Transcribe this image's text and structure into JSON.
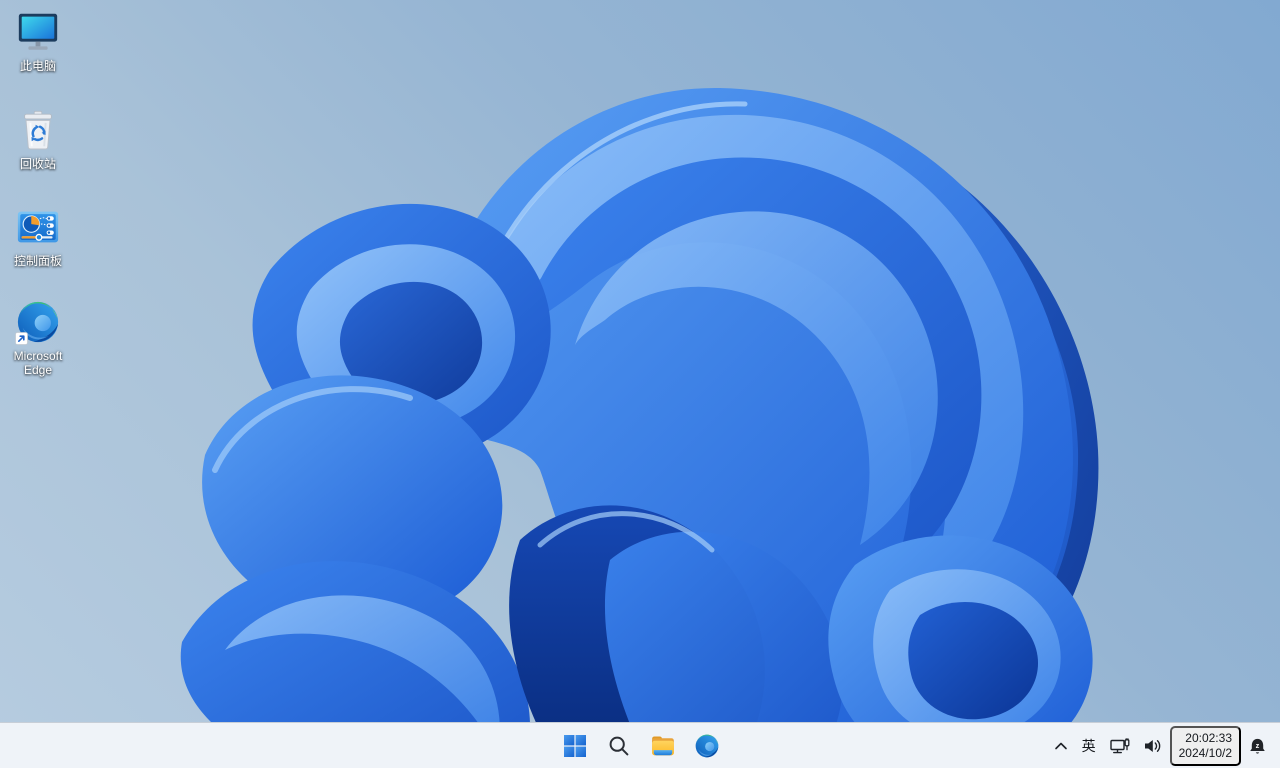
{
  "desktop": {
    "icons": [
      {
        "label": "此电脑",
        "icon": "this-pc-monitor-icon"
      },
      {
        "label": "回收站",
        "icon": "recycle-bin-icon"
      },
      {
        "label": "控制面板",
        "icon": "control-panel-icon"
      },
      {
        "label": "Microsoft Edge",
        "icon": "edge-browser-icon-with-shortcut-arrow"
      }
    ],
    "wallpaper": "windows-11-bloom-blue"
  },
  "taskbar": {
    "buttons": [
      {
        "icon": "windows-start-icon"
      },
      {
        "icon": "search-icon"
      },
      {
        "icon": "file-explorer-folder-icon"
      },
      {
        "icon": "edge-browser-icon"
      }
    ],
    "tray": {
      "icons": [
        "chevron-up-icon",
        "ime-indicator",
        "ethernet-network-icon",
        "volume-icon",
        "notification-bell-dnd-icon"
      ],
      "ime_label": "英",
      "clock": {
        "time": "20:02:33",
        "date": "2024/10/2"
      }
    }
  },
  "colors": {
    "taskbar_bg": "#eff3f8",
    "wallpaper_top_right": "#82a9d1",
    "wallpaper_bottom_left": "#b6cce0",
    "bloom_bright": "#3c84ee",
    "bloom_light": "#8fc0f8",
    "bloom_deep": "#0b3596",
    "icon_label_text": "#ffffff",
    "tray_text": "#15181d"
  }
}
